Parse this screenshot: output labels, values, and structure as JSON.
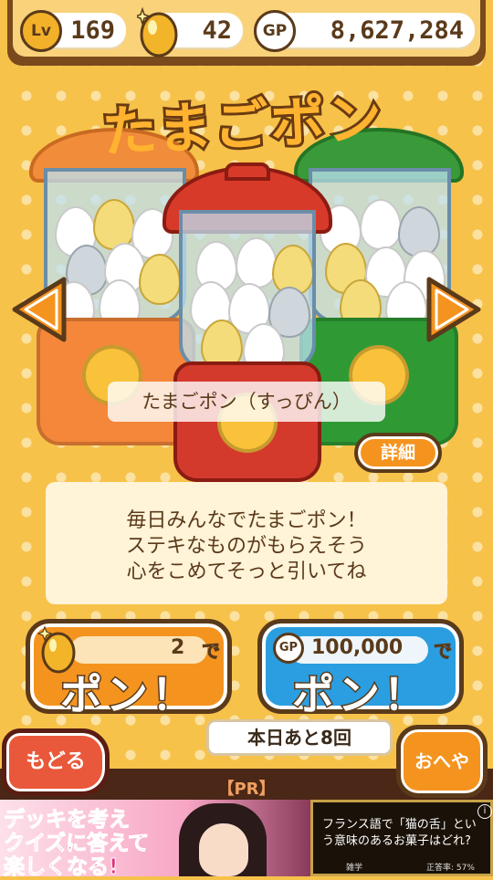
{
  "status": {
    "level_badge": "Lv",
    "level": "169",
    "eggs": "42",
    "gp_badge": "GP",
    "gp": "8,627,284"
  },
  "title": "たまごポン",
  "machine": {
    "label": "たまごポン（すっぴん）",
    "detail_label": "詳細"
  },
  "description": {
    "lines": [
      "毎日みんなでたまごポン！",
      "ステキなものがもらえそう",
      "心をこめてそっと引いてね"
    ]
  },
  "draw_egg": {
    "price": "2",
    "suffix": "で",
    "label": "ポン！"
  },
  "draw_gp": {
    "badge": "GP",
    "price": "100,000",
    "suffix": "で",
    "label": "ポン！"
  },
  "remaining": "本日あと8回",
  "nav": {
    "back": "もどる",
    "room": "おへや"
  },
  "ad": {
    "pr": "【PR】",
    "left_lines": [
      "デッキを考え",
      "クイズに答えて",
      "楽しくなる!"
    ],
    "right_text": "フランス語で「猫の舌」という意味のあるお菓子はどれ?",
    "genre": "雑学",
    "rate": "正答率: 57%",
    "info": "i"
  },
  "colors": {
    "orange": "#f4941f",
    "red": "#d83a2a",
    "green": "#3aa03a",
    "blue": "#2a9ee0",
    "brown": "#5a3a1a"
  }
}
